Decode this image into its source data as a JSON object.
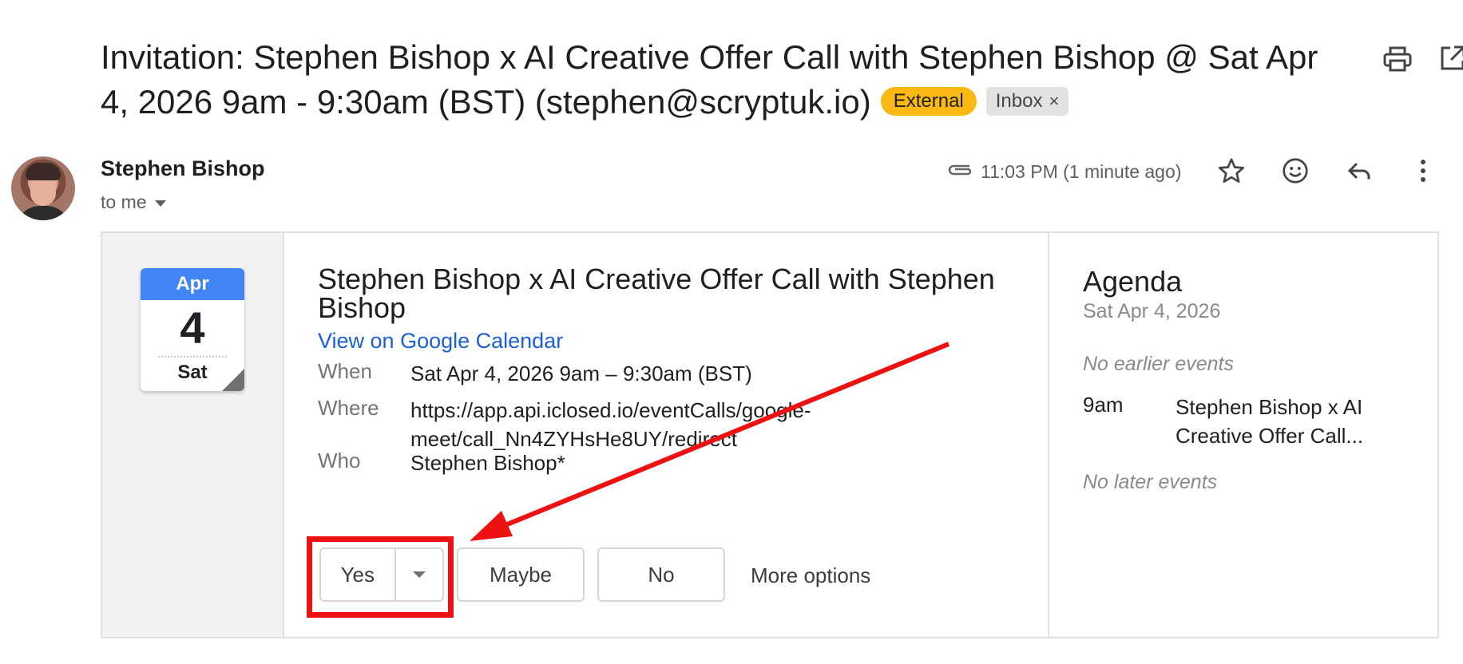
{
  "email": {
    "subject": "Invitation: Stephen Bishop x AI Creative Offer Call with Stephen Bishop @ Sat Apr 4, 2026 9am - 9:30am (BST) (stephen@scryptuk.io)",
    "labels": {
      "external": "External",
      "inbox": "Inbox",
      "inbox_remove": "×"
    },
    "sender": "Stephen Bishop",
    "recipient": "to me",
    "timestamp": "11:03 PM (1 minute ago)",
    "icons": [
      "print-icon",
      "open-in-new-window-icon",
      "attachment-icon",
      "star-icon",
      "emoji-icon",
      "reply-icon",
      "more-vert-icon",
      "dropdown-caret-icon"
    ]
  },
  "invite": {
    "calendar_badge": {
      "month": "Apr",
      "day": "4",
      "weekday": "Sat"
    },
    "title": "Stephen Bishop x AI Creative Offer Call with Stephen Bishop",
    "calendar_link": "View on Google Calendar",
    "details": {
      "when_label": "When",
      "when_value": "Sat Apr 4, 2026 9am – 9:30am (BST)",
      "where_label": "Where",
      "where_value": "https://app.api.iclosed.io/eventCalls/google-meet/call_Nn4ZYHsHe8UY/redirect",
      "who_label": "Who",
      "who_value": "Stephen Bishop*"
    },
    "rsvp": {
      "yes": "Yes",
      "maybe": "Maybe",
      "no": "No",
      "more": "More options"
    }
  },
  "agenda": {
    "title": "Agenda",
    "date": "Sat Apr 4, 2026",
    "no_earlier": "No earlier events",
    "event_time": "9am",
    "event_title": "Stephen Bishop x AI Creative Offer Call...",
    "no_later": "No later events"
  },
  "colors": {
    "external_badge": "#f9b912",
    "link": "#1a5fd6",
    "calendar_header": "#4285f4",
    "annotation": "#ee1111"
  }
}
